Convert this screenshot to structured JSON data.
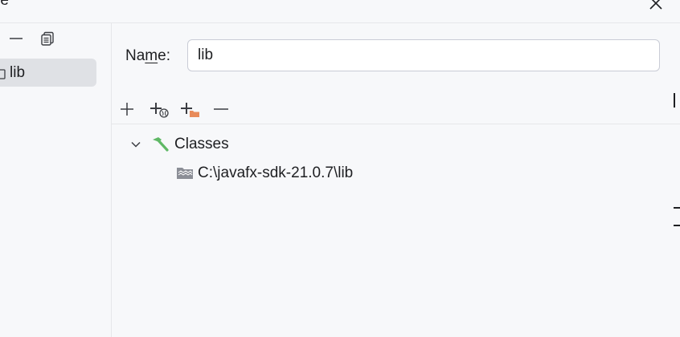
{
  "window": {
    "title_fragment": "re",
    "close_icon": "close-icon"
  },
  "left_pane": {
    "toolbar": [
      {
        "name": "remove-library-button",
        "icon": "minus-icon"
      },
      {
        "name": "copy-library-button",
        "icon": "copy-icon"
      }
    ],
    "items": [
      {
        "label": "lib",
        "icon": "library-folder-icon",
        "selected": true
      }
    ]
  },
  "detail": {
    "name_label_prefix": "Na",
    "name_label_mnemonic": "m",
    "name_label_suffix": "e:",
    "name_value": "lib",
    "toolbar": [
      {
        "name": "add-button",
        "icon": "plus-icon"
      },
      {
        "name": "attach-url-button",
        "icon": "plus-globe-icon"
      },
      {
        "name": "attach-jar-directories-button",
        "icon": "plus-folder-icon"
      },
      {
        "name": "remove-button",
        "icon": "minus-icon"
      }
    ]
  },
  "tree": {
    "root": {
      "label": "Classes",
      "icon": "hammer-icon",
      "expanded": true
    },
    "children": [
      {
        "label": "C:\\javafx-sdk-21.0.7\\lib",
        "icon": "jar-directory-icon"
      }
    ]
  },
  "colors": {
    "background": "#f7f8fa",
    "selection": "#dfe1e5",
    "border": "#e6e7ea",
    "hammer_green": "#5fb865",
    "folder_orange": "#e88b5a"
  }
}
